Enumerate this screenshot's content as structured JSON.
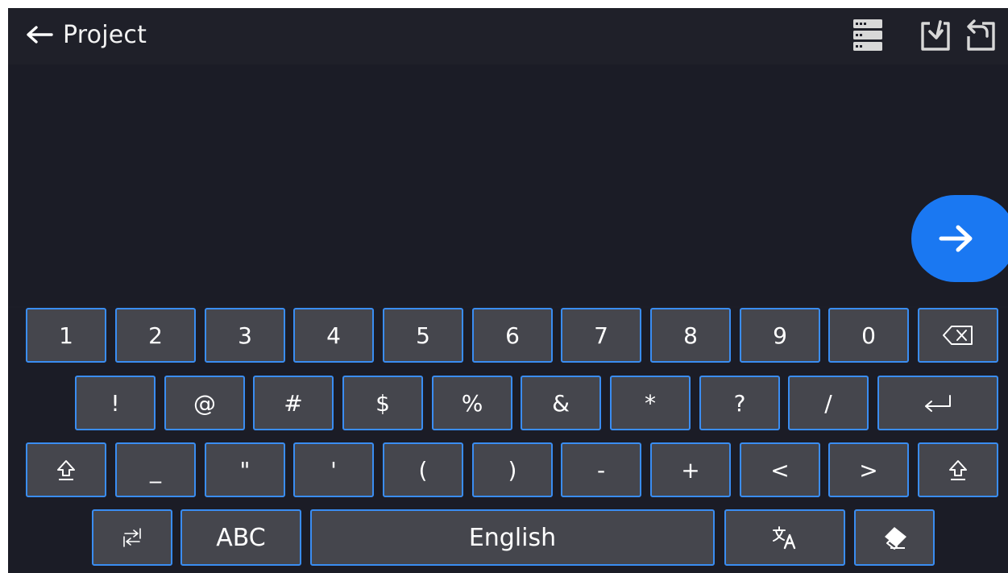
{
  "header": {
    "title": "Project",
    "back_icon": "left-arrow-icon",
    "icons": [
      "database-list-icon",
      "import-icon",
      "export-icon"
    ]
  },
  "submit_icon": "right-arrow-icon",
  "colors": {
    "background": "#1c1d27",
    "key_fill": "#45464d",
    "key_border": "#3a8df2",
    "accent": "#1a78f2"
  },
  "keyboard": {
    "row1": [
      "1",
      "2",
      "3",
      "4",
      "5",
      "6",
      "7",
      "8",
      "9",
      "0"
    ],
    "row2": [
      "!",
      "@",
      "#",
      "$",
      "%",
      "&",
      "*",
      "?",
      "/"
    ],
    "row3": [
      "_",
      "\"",
      "'",
      "(",
      ")",
      "-",
      "+",
      "<",
      ">"
    ],
    "abc_label": "ABC",
    "space_label": "English",
    "special_icons": {
      "backspace": "backspace-icon",
      "enter": "enter-icon",
      "shift": "shift-icon",
      "switch": "switch-layout-icon",
      "language": "translate-icon",
      "clear": "eraser-icon"
    }
  }
}
